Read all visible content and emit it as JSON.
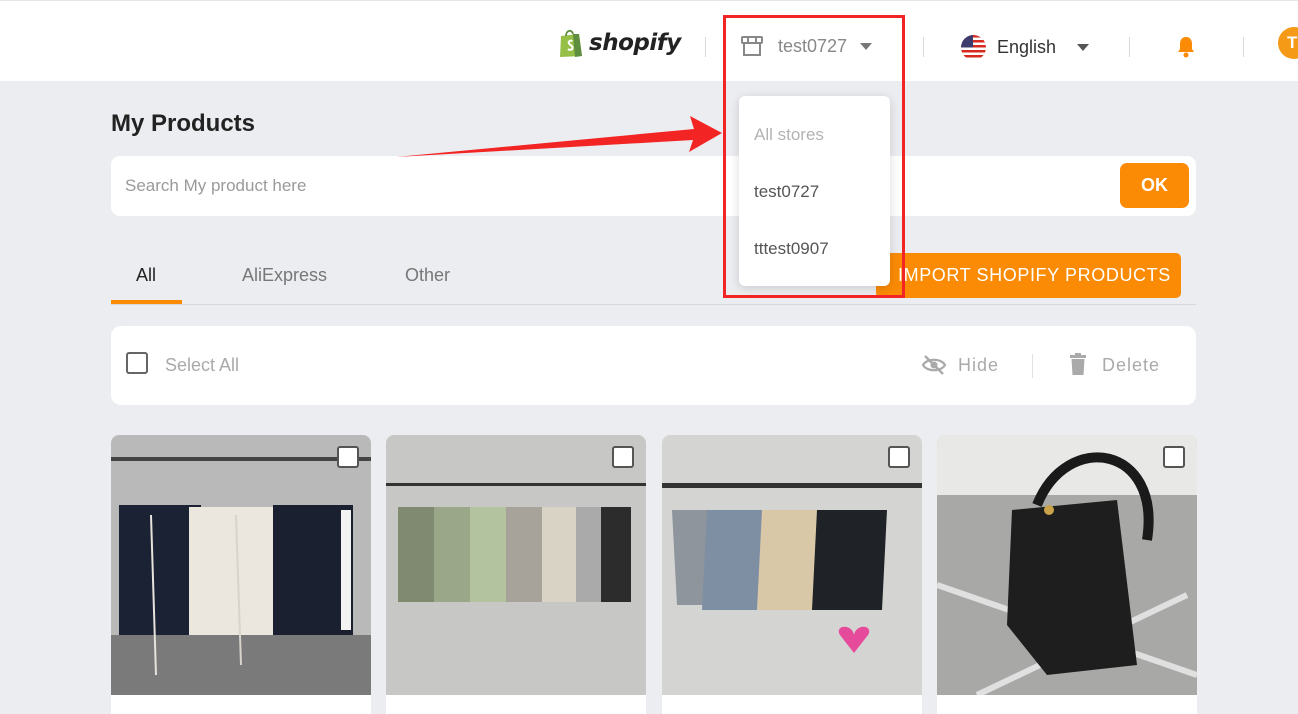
{
  "header": {
    "brand": "shopify",
    "store_selector": {
      "current": "test0727"
    },
    "language_selector": {
      "current": "English"
    },
    "avatar_initial": "T"
  },
  "store_dropdown": {
    "items": [
      {
        "label": "All stores"
      },
      {
        "label": "test0727"
      },
      {
        "label": "tttest0907"
      }
    ]
  },
  "page": {
    "title": "My Products",
    "search": {
      "placeholder": "Search My product here",
      "value": "",
      "ok_label": "OK"
    },
    "tabs": [
      {
        "label": "All",
        "active": true
      },
      {
        "label": "AliExpress",
        "active": false
      },
      {
        "label": "Other",
        "active": false
      }
    ],
    "import_button": "IMPORT SHOPIFY PRODUCTS",
    "actions": {
      "select_all": "Select All",
      "hide": "Hide",
      "delete": "Delete"
    }
  },
  "products": [
    {
      "image": "shorts-hanging-rack-black-white"
    },
    {
      "image": "shorts-hanging-rack-pastel"
    },
    {
      "image": "shorts-on-hangers-grey-beige-black"
    },
    {
      "image": "black-leather-bucket-bag"
    }
  ],
  "colors": {
    "accent": "#fb8b05",
    "highlight": "#f22424",
    "background": "#ecedf0",
    "shopify_green": "#95bf47"
  }
}
